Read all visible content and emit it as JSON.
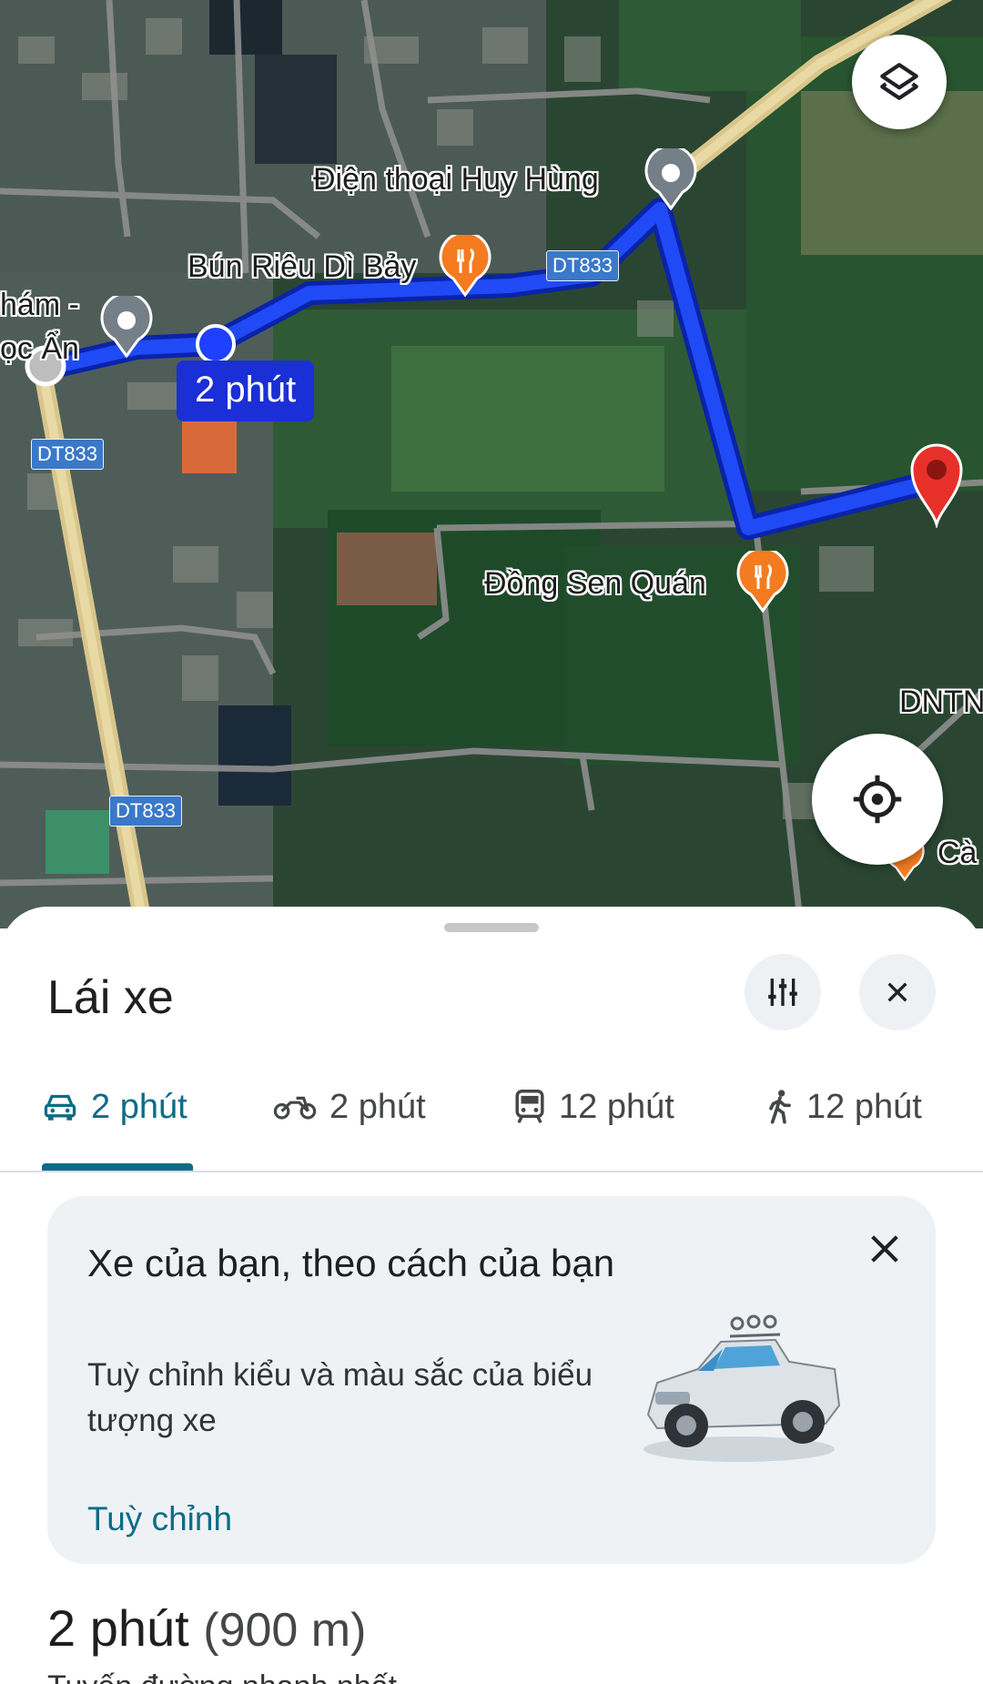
{
  "map": {
    "labels": {
      "phone_shop": "Điện thoại Huy Hùng",
      "bun_rieu": "Bún Riêu Dì Bảy",
      "dong_sen": "Đồng Sen Quán",
      "left_place_top": "hám -",
      "left_place_bottom": "ọc Ẩn",
      "dntn": "DNTN",
      "ca": "Cà"
    },
    "road_shields": [
      "DT833",
      "DT833",
      "DT833"
    ],
    "route_time": "2 phút",
    "colors": {
      "route": "#1a3ee8",
      "destination_pin": "#d93025",
      "poi_food": "#f47b20"
    }
  },
  "sheet": {
    "title": "Lái xe",
    "options_icon": "tune-icon",
    "close_icon": "close-icon",
    "modes": [
      {
        "icon": "car-icon",
        "label": "2 phút",
        "selected": true
      },
      {
        "icon": "motorbike-icon",
        "label": "2 phút",
        "selected": false
      },
      {
        "icon": "transit-icon",
        "label": "12 phút",
        "selected": false
      },
      {
        "icon": "walk-icon",
        "label": "12 phút",
        "selected": false
      }
    ],
    "promo": {
      "title": "Xe của bạn, theo cách của bạn",
      "description": "Tuỳ chỉnh kiểu và màu sắc của biểu tượng xe",
      "link": "Tuỳ chỉnh"
    },
    "summary": {
      "time": "2 phút",
      "distance": "(900 m)"
    },
    "next_line": "Tuyến đường nhanh nhất"
  }
}
